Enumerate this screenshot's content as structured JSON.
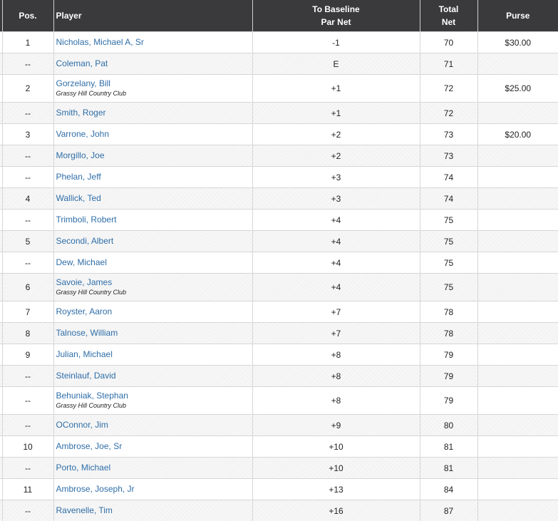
{
  "header": {
    "pos": "Pos.",
    "player": "Player",
    "baseline_line1": "To Baseline",
    "baseline_line2": "Par Net",
    "total_line1": "Total",
    "total_line2": "Net",
    "purse": "Purse"
  },
  "rows": [
    {
      "pos": "1",
      "player": "Nicholas, Michael A, Sr",
      "club": "",
      "par": "-1",
      "total": "70",
      "purse": "$30.00"
    },
    {
      "pos": "--",
      "player": "Coleman, Pat",
      "club": "",
      "par": "E",
      "total": "71",
      "purse": ""
    },
    {
      "pos": "2",
      "player": "Gorzelany, Bill",
      "club": "Grassy Hill Country Club",
      "par": "+1",
      "total": "72",
      "purse": "$25.00"
    },
    {
      "pos": "--",
      "player": "Smith, Roger",
      "club": "",
      "par": "+1",
      "total": "72",
      "purse": ""
    },
    {
      "pos": "3",
      "player": "Varrone, John",
      "club": "",
      "par": "+2",
      "total": "73",
      "purse": "$20.00"
    },
    {
      "pos": "--",
      "player": "Morgillo, Joe",
      "club": "",
      "par": "+2",
      "total": "73",
      "purse": ""
    },
    {
      "pos": "--",
      "player": "Phelan, Jeff",
      "club": "",
      "par": "+3",
      "total": "74",
      "purse": ""
    },
    {
      "pos": "4",
      "player": "Wallick, Ted",
      "club": "",
      "par": "+3",
      "total": "74",
      "purse": ""
    },
    {
      "pos": "--",
      "player": "Trimboli, Robert",
      "club": "",
      "par": "+4",
      "total": "75",
      "purse": ""
    },
    {
      "pos": "5",
      "player": "Secondi, Albert",
      "club": "",
      "par": "+4",
      "total": "75",
      "purse": ""
    },
    {
      "pos": "--",
      "player": "Dew, Michael",
      "club": "",
      "par": "+4",
      "total": "75",
      "purse": ""
    },
    {
      "pos": "6",
      "player": "Savoie, James",
      "club": "Grassy Hill Country Club",
      "par": "+4",
      "total": "75",
      "purse": ""
    },
    {
      "pos": "7",
      "player": "Royster, Aaron",
      "club": "",
      "par": "+7",
      "total": "78",
      "purse": ""
    },
    {
      "pos": "8",
      "player": "Talnose, William",
      "club": "",
      "par": "+7",
      "total": "78",
      "purse": ""
    },
    {
      "pos": "9",
      "player": "Julian, Michael",
      "club": "",
      "par": "+8",
      "total": "79",
      "purse": ""
    },
    {
      "pos": "--",
      "player": "Steinlauf, David",
      "club": "",
      "par": "+8",
      "total": "79",
      "purse": ""
    },
    {
      "pos": "--",
      "player": "Behuniak, Stephan",
      "club": "Grassy Hill Country Club",
      "par": "+8",
      "total": "79",
      "purse": ""
    },
    {
      "pos": "--",
      "player": "OConnor, Jim",
      "club": "",
      "par": "+9",
      "total": "80",
      "purse": ""
    },
    {
      "pos": "10",
      "player": "Ambrose, Joe, Sr",
      "club": "",
      "par": "+10",
      "total": "81",
      "purse": ""
    },
    {
      "pos": "--",
      "player": "Porto, Michael",
      "club": "",
      "par": "+10",
      "total": "81",
      "purse": ""
    },
    {
      "pos": "11",
      "player": "Ambrose, Joseph, Jr",
      "club": "",
      "par": "+13",
      "total": "84",
      "purse": ""
    },
    {
      "pos": "--",
      "player": "Ravenelle, Tim",
      "club": "",
      "par": "+16",
      "total": "87",
      "purse": ""
    }
  ]
}
